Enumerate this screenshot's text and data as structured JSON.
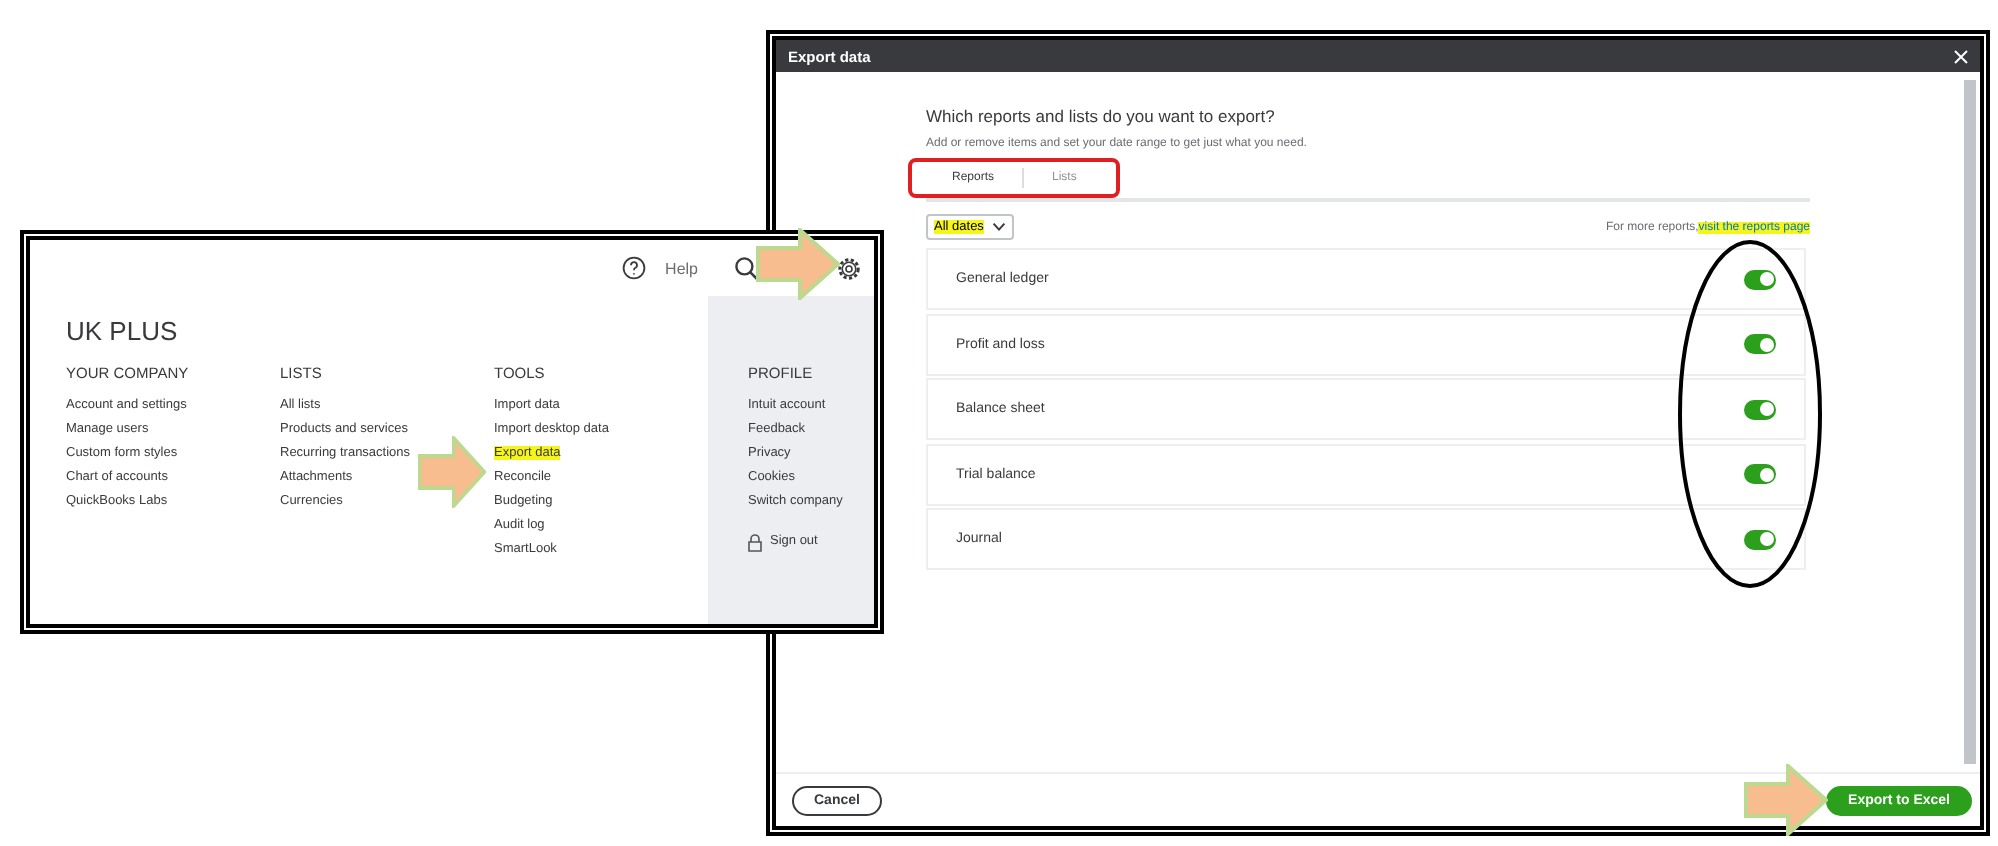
{
  "settings_menu": {
    "help": "Help",
    "company": "UK PLUS",
    "columns": [
      {
        "heading": "YOUR COMPANY",
        "kind": "plain",
        "items": [
          {
            "label": "Account and settings",
            "highlighted": false
          },
          {
            "label": "Manage users",
            "highlighted": false
          },
          {
            "label": "Custom form styles",
            "highlighted": false
          },
          {
            "label": "Chart of accounts",
            "highlighted": false
          },
          {
            "label": "QuickBooks Labs",
            "highlighted": false
          }
        ]
      },
      {
        "heading": "LISTS",
        "kind": "plain",
        "items": [
          {
            "label": "All lists",
            "highlighted": false
          },
          {
            "label": "Products and services",
            "highlighted": false
          },
          {
            "label": "Recurring transactions",
            "highlighted": false
          },
          {
            "label": "Attachments",
            "highlighted": false
          },
          {
            "label": "Currencies",
            "highlighted": false
          }
        ]
      },
      {
        "heading": "TOOLS",
        "kind": "plain",
        "items": [
          {
            "label": "Import data",
            "highlighted": false
          },
          {
            "label": "Import desktop data",
            "highlighted": false
          },
          {
            "label": "Export data",
            "highlighted": true
          },
          {
            "label": "Reconcile",
            "highlighted": false
          },
          {
            "label": "Budgeting",
            "highlighted": false
          },
          {
            "label": "Audit log",
            "highlighted": false
          },
          {
            "label": "SmartLook",
            "highlighted": false
          }
        ]
      },
      {
        "heading": "PROFILE",
        "kind": "profile",
        "items": [
          {
            "label": "Intuit account",
            "highlighted": false
          },
          {
            "label": "Feedback",
            "highlighted": false
          },
          {
            "label": "Privacy",
            "highlighted": false
          },
          {
            "label": "Cookies",
            "highlighted": false
          },
          {
            "label": "Switch company",
            "highlighted": false
          }
        ],
        "sign_out": "Sign out"
      }
    ]
  },
  "export_dialog": {
    "title": "Export data",
    "question": "Which reports and lists do you want to export?",
    "subtitle": "Add or remove items and set your date range to get just what you need.",
    "tabs": [
      {
        "label": "Reports",
        "selected": true
      },
      {
        "label": "Lists",
        "selected": false
      }
    ],
    "date_filter": {
      "value": "All dates",
      "highlighted": true
    },
    "more_reports": "For more reports,",
    "reports_link": {
      "label": "visit the reports page",
      "highlighted": true
    },
    "reports": [
      {
        "name": "General ledger",
        "on": true
      },
      {
        "name": "Profit and loss",
        "on": true
      },
      {
        "name": "Balance sheet",
        "on": true
      },
      {
        "name": "Trial balance",
        "on": true
      },
      {
        "name": "Journal",
        "on": true
      }
    ],
    "cancel": "Cancel",
    "export": "Export to Excel"
  }
}
